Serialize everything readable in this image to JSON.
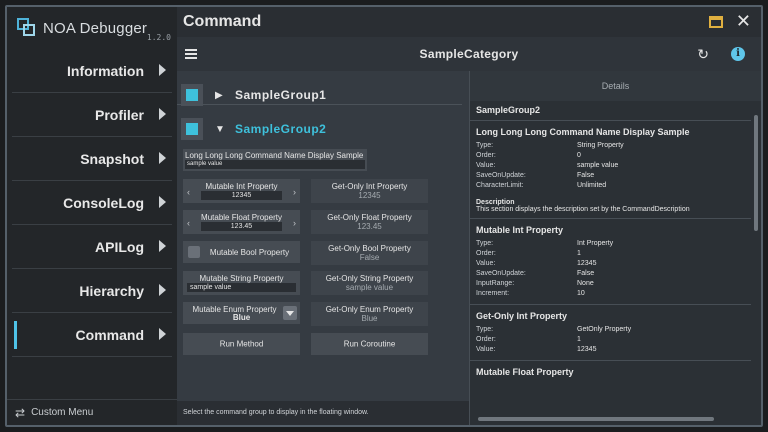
{
  "app": {
    "name": "NOA Debugger",
    "version": "1.2.0"
  },
  "sidebar": {
    "items": [
      {
        "label": "Information"
      },
      {
        "label": "Profiler"
      },
      {
        "label": "Snapshot"
      },
      {
        "label": "ConsoleLog"
      },
      {
        "label": "APILog"
      },
      {
        "label": "Hierarchy"
      },
      {
        "label": "Command",
        "active": true
      }
    ],
    "custom_menu": "Custom Menu"
  },
  "header": {
    "title": "Command"
  },
  "subheader": {
    "category": "SampleCategory"
  },
  "groups": [
    {
      "name": "SampleGroup1",
      "expanded": false
    },
    {
      "name": "SampleGroup2",
      "expanded": true,
      "color": "#3ec1dc"
    }
  ],
  "commands": {
    "long": {
      "label": "Long Long Long Command Name Display Sample",
      "value": "sample value"
    },
    "mut_int": {
      "label": "Mutable Int Property",
      "value": "12345"
    },
    "get_int": {
      "label": "Get-Only Int Property",
      "value": "12345"
    },
    "mut_float": {
      "label": "Mutable Float Property",
      "value": "123.45"
    },
    "get_float": {
      "label": "Get-Only Float Property",
      "value": "123.45"
    },
    "mut_bool": {
      "label": "Mutable Bool Property"
    },
    "get_bool": {
      "label": "Get-Only Bool Property",
      "value": "False"
    },
    "mut_string": {
      "label": "Mutable String Property",
      "value": "sample value"
    },
    "get_string": {
      "label": "Get-Only String Property",
      "value": "sample value"
    },
    "mut_enum": {
      "label": "Mutable Enum Property",
      "value": "Blue"
    },
    "get_enum": {
      "label": "Get-Only Enum Property",
      "value": "Blue"
    },
    "run_method": {
      "label": "Run Method"
    },
    "run_coroutine": {
      "label": "Run Coroutine"
    }
  },
  "footer": {
    "text": "Select the command group to display in the floating window."
  },
  "details": {
    "header": "Details",
    "group": "SampleGroup2",
    "sections": [
      {
        "title": "Long Long Long Command Name Display Sample",
        "rows": [
          {
            "k": "Type:",
            "v": "String Property"
          },
          {
            "k": "Order:",
            "v": "0"
          },
          {
            "k": "Value:",
            "v": "sample value"
          },
          {
            "k": "SaveOnUpdate:",
            "v": "False"
          },
          {
            "k": "CharacterLimit:",
            "v": "Unlimited"
          }
        ],
        "desc_title": "Description",
        "desc": "This section displays the description set by the CommandDescription"
      },
      {
        "title": "Mutable Int Property",
        "rows": [
          {
            "k": "Type:",
            "v": "Int Property"
          },
          {
            "k": "Order:",
            "v": "1"
          },
          {
            "k": "Value:",
            "v": "12345"
          },
          {
            "k": "SaveOnUpdate:",
            "v": "False"
          },
          {
            "k": "InputRange:",
            "v": "None"
          },
          {
            "k": "Increment:",
            "v": "10"
          }
        ]
      },
      {
        "title": "Get-Only Int Property",
        "rows": [
          {
            "k": "Type:",
            "v": "GetOnly Property"
          },
          {
            "k": "Order:",
            "v": "1"
          },
          {
            "k": "Value:",
            "v": "12345"
          }
        ]
      },
      {
        "title": "Mutable Float Property",
        "rows": []
      }
    ]
  }
}
